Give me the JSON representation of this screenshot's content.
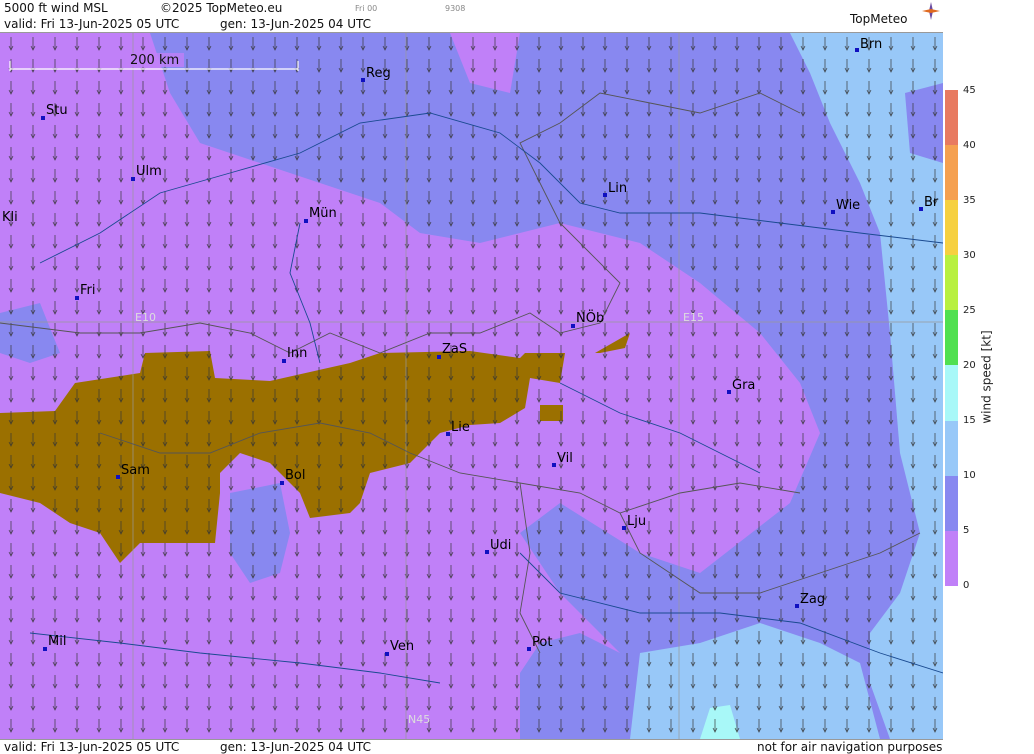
{
  "header": {
    "product": "5000 ft wind MSL",
    "copyright": "©2025 TopMeteo.eu",
    "run_short": "Fri 00",
    "code": "9308",
    "valid": "valid:  Fri  13-Jun-2025  05 UTC",
    "gen": "gen: 13-Jun-2025 04 UTC",
    "logo_text": "TopMeteo"
  },
  "footer": {
    "valid": "valid:  Fri  13-Jun-2025  05 UTC",
    "gen": "gen: 13-Jun-2025 04 UTC",
    "disclaimer": "not for air navigation purposes"
  },
  "map": {
    "scale_label": "200 km",
    "grid_labels": [
      "E10",
      "E15",
      "N45"
    ],
    "cities": [
      {
        "name": "Brn"
      },
      {
        "name": "Reg"
      },
      {
        "name": "Stu"
      },
      {
        "name": "Ulm"
      },
      {
        "name": "Lin"
      },
      {
        "name": "Wie"
      },
      {
        "name": "Br"
      },
      {
        "name": "Kli"
      },
      {
        "name": "Mün"
      },
      {
        "name": "Fri"
      },
      {
        "name": "NÖb"
      },
      {
        "name": "Inn"
      },
      {
        "name": "ZaS"
      },
      {
        "name": "Gra"
      },
      {
        "name": "Lie"
      },
      {
        "name": "Vil"
      },
      {
        "name": "Sam"
      },
      {
        "name": "Bol"
      },
      {
        "name": "Lju"
      },
      {
        "name": "Udi"
      },
      {
        "name": "Zag"
      },
      {
        "name": "Mil"
      },
      {
        "name": "Ven"
      },
      {
        "name": "Pot"
      }
    ]
  },
  "legend": {
    "title": "wind speed [kt]",
    "ticks": [
      "45",
      "40",
      "35",
      "30",
      "25",
      "20",
      "15",
      "10",
      "5",
      "0"
    ],
    "colors": [
      "#e87a60",
      "#f5a050",
      "#f6d040",
      "#f8f860",
      "#b8f040",
      "#50e050",
      "#a8f8f8",
      "#98c8f8",
      "#8888f0",
      "#c080f8"
    ]
  }
}
